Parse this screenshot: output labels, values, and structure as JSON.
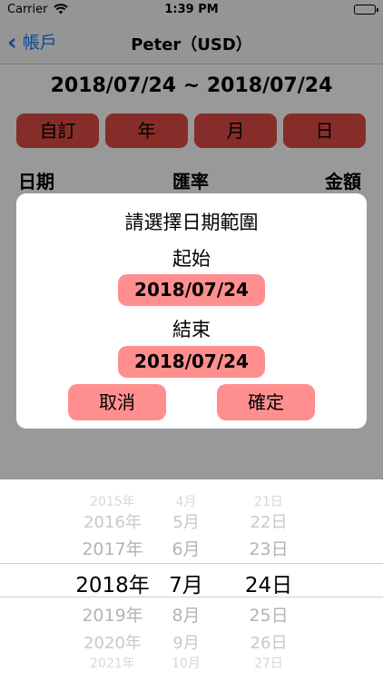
{
  "status_bar": {
    "carrier": "Carrier",
    "time": "1:39 PM"
  },
  "nav": {
    "back_label": "帳戶",
    "title": "Peter（USD）"
  },
  "date_range_title": "2018/07/24 ~ 2018/07/24",
  "segments": [
    "自訂",
    "年",
    "月",
    "日"
  ],
  "columns": {
    "date": "日期",
    "rate": "匯率",
    "amount": "金額"
  },
  "dialog": {
    "title": "請選擇日期範圍",
    "start_label": "起始",
    "start_value": "2018/07/24",
    "end_label": "結束",
    "end_value": "2018/07/24",
    "cancel_label": "取消",
    "confirm_label": "確定"
  },
  "picker": {
    "years": [
      "2015年",
      "2016年",
      "2017年",
      "2018年",
      "2019年",
      "2020年",
      "2021年"
    ],
    "months": [
      "4月",
      "5月",
      "6月",
      "7月",
      "8月",
      "9月",
      "10月"
    ],
    "days": [
      "21日",
      "22日",
      "23日",
      "24日",
      "25日",
      "26日",
      "27日"
    ]
  },
  "colors": {
    "accent_blue": "#1a7af8",
    "segment_red": "#e04b46",
    "button_pink": "#ff8f8e"
  }
}
